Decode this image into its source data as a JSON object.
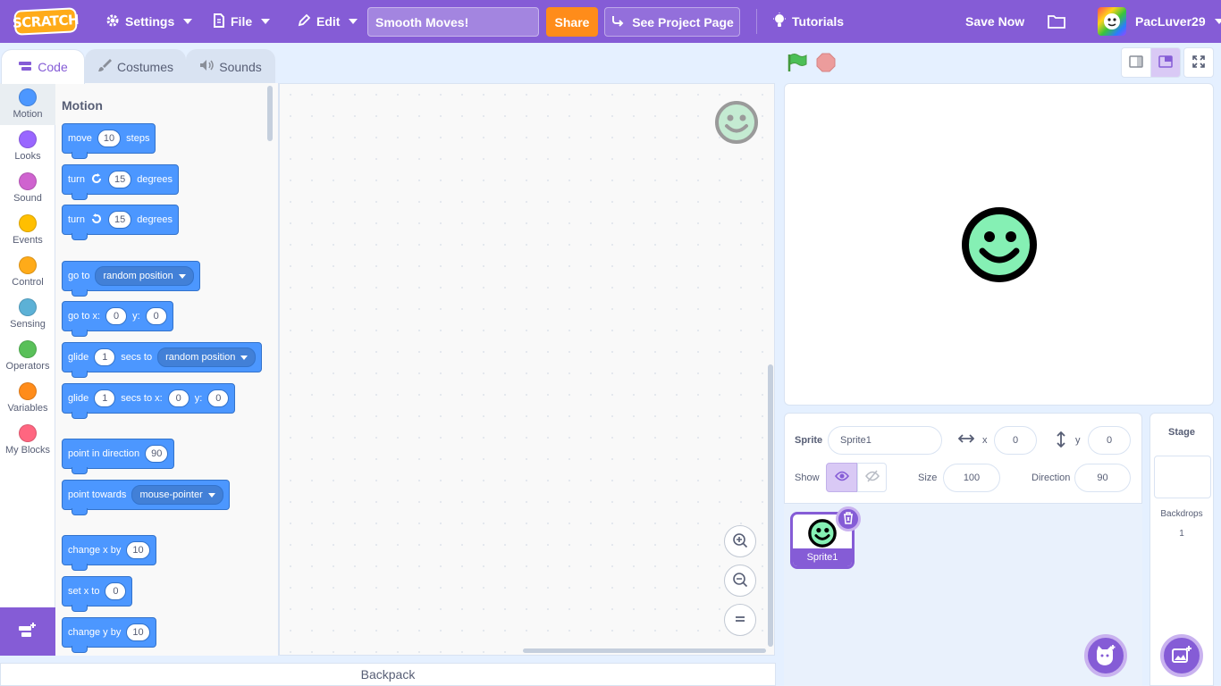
{
  "menubar": {
    "logo": "SCRATCH",
    "settings": "Settings",
    "file": "File",
    "edit": "Edit",
    "project_title": "Smooth Moves!",
    "share": "Share",
    "see_project_page": "See Project Page",
    "tutorials": "Tutorials",
    "save_now": "Save Now",
    "username": "PacLuver29"
  },
  "tabs": {
    "code": "Code",
    "costumes": "Costumes",
    "sounds": "Sounds"
  },
  "categories": [
    {
      "label": "Motion",
      "color": "#4c97ff"
    },
    {
      "label": "Looks",
      "color": "#9966ff"
    },
    {
      "label": "Sound",
      "color": "#cf63cf"
    },
    {
      "label": "Events",
      "color": "#ffbf00"
    },
    {
      "label": "Control",
      "color": "#ffab19"
    },
    {
      "label": "Sensing",
      "color": "#5cb1d6"
    },
    {
      "label": "Operators",
      "color": "#59c059"
    },
    {
      "label": "Variables",
      "color": "#ff8c1a"
    },
    {
      "label": "My Blocks",
      "color": "#ff6680"
    }
  ],
  "palette": {
    "heading": "Motion",
    "move": {
      "a": "move",
      "v": "10",
      "b": "steps"
    },
    "turn_right": {
      "a": "turn",
      "v": "15",
      "b": "degrees"
    },
    "turn_left": {
      "a": "turn",
      "v": "15",
      "b": "degrees"
    },
    "goto": {
      "a": "go to",
      "d": "random position"
    },
    "gotoxy": {
      "a": "go to x:",
      "x": "0",
      "b": "y:",
      "y": "0"
    },
    "glide_to": {
      "a": "glide",
      "v": "1",
      "b": "secs to",
      "d": "random position"
    },
    "glide_xy": {
      "a": "glide",
      "v": "1",
      "b": "secs to x:",
      "x": "0",
      "c": "y:",
      "y": "0"
    },
    "point_dir": {
      "a": "point in direction",
      "v": "90"
    },
    "point_towards": {
      "a": "point towards",
      "d": "mouse-pointer"
    },
    "change_x": {
      "a": "change x by",
      "v": "10"
    },
    "set_x": {
      "a": "set x to",
      "v": "0"
    },
    "change_y": {
      "a": "change y by",
      "v": "10"
    }
  },
  "backpack": "Backpack",
  "sprite_info": {
    "sprite_label": "Sprite",
    "sprite_name": "Sprite1",
    "x_label": "x",
    "x_value": "0",
    "y_label": "y",
    "y_value": "0",
    "show_label": "Show",
    "size_label": "Size",
    "size_value": "100",
    "direction_label": "Direction",
    "direction_value": "90"
  },
  "sprites": [
    {
      "name": "Sprite1"
    }
  ],
  "stage_pane": {
    "title": "Stage",
    "backdrops_label": "Backdrops",
    "backdrops_count": "1"
  },
  "colors": {
    "accent": "#855cd6",
    "motion": "#4c97ff",
    "share": "#ff8c1a",
    "sprite_fill": "#85f0b4"
  }
}
